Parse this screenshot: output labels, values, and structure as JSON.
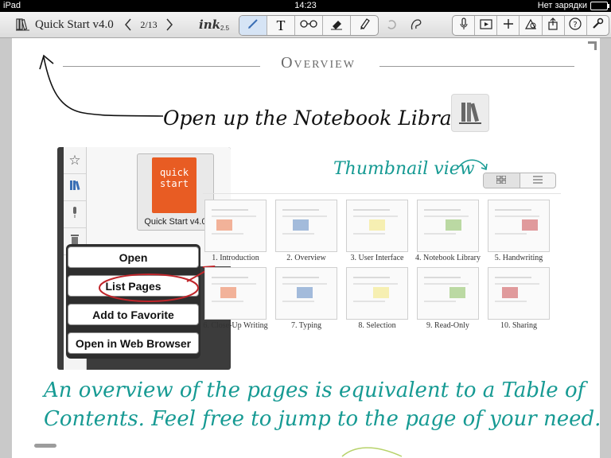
{
  "status_bar": {
    "device": "iPad",
    "time": "14:23",
    "battery_text": "Нет зарядки"
  },
  "toolbar": {
    "doc_title": "Quick Start v4.0",
    "page_indicator": "2/13",
    "ink_label": "ink",
    "ink_size": "2.5",
    "icons": [
      "library-icon",
      "prev-page-icon",
      "next-page-icon",
      "pen-icon",
      "text-icon",
      "glasses-icon",
      "eraser-icon",
      "highlighter-icon",
      "undo-icon",
      "lasso-icon",
      "microphone-icon",
      "media-icon",
      "plus-icon",
      "shapes-icon",
      "share-icon",
      "help-icon",
      "settings-icon"
    ]
  },
  "page": {
    "heading": "Overview",
    "note_library": "Open up the Notebook Library",
    "note_thumbnail": "Thumbnail view",
    "note_bottom_line1": "An overview of the pages is equivalent to a Table of",
    "note_bottom_line2": "Contents. Feel free to jump to the page of your need.",
    "ink_color": "#169a93",
    "book": {
      "cover_line1": "quick",
      "cover_line2": "start",
      "label": "Quick Start v4.0",
      "cover_color": "#e85c23"
    },
    "context_menu": [
      "Open",
      "List Pages",
      "Add to Favorite",
      "Open in Web Browser"
    ],
    "thumbnails": [
      "1. Introduction",
      "2. Overview",
      "3. User Interface",
      "4. Notebook Library",
      "5. Handwriting",
      "6. Close-Up Writing",
      "7. Typing",
      "8. Selection",
      "9. Read-Only",
      "10. Sharing"
    ]
  }
}
